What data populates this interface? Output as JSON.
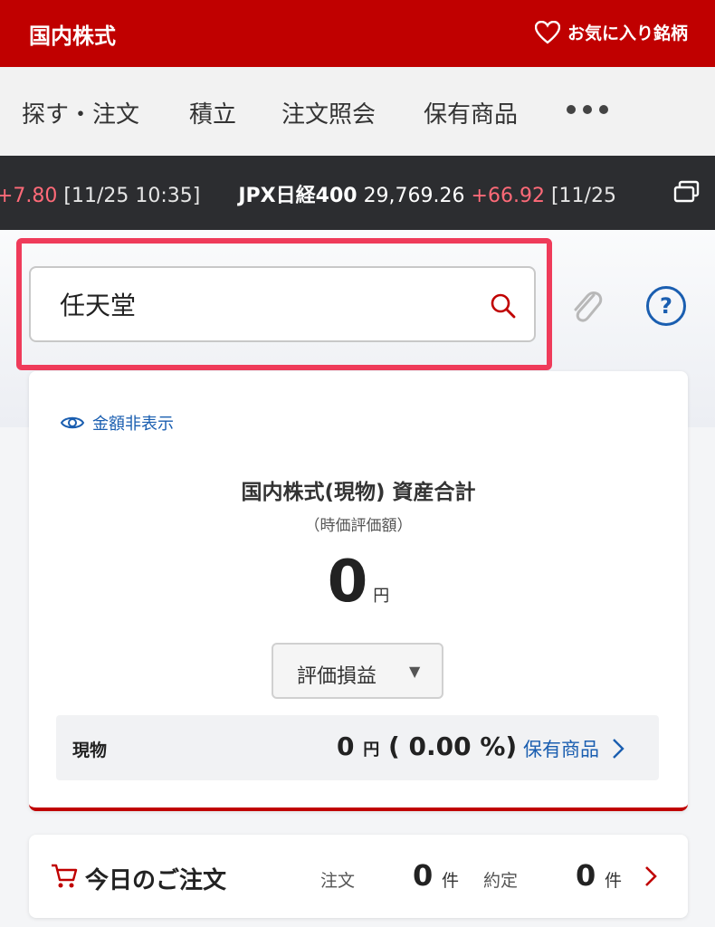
{
  "header": {
    "title": "国内株式",
    "favorites_label": "お気に入り銘柄"
  },
  "nav": {
    "items": [
      "探す・注文",
      "積立",
      "注文照会",
      "保有商品"
    ],
    "more_icon": "ellipsis-icon"
  },
  "ticker": {
    "prev_change": "+7.80",
    "prev_time": "[11/25 10:35]",
    "index_name": "JPX日経400",
    "index_value": "29,769.26",
    "index_change": "+66.92",
    "index_time": "[11/25"
  },
  "search": {
    "value": "任天堂"
  },
  "summary": {
    "toggle_label": "金額非表示",
    "title": "国内株式(現物) 資産合計",
    "subtitle": "（時価評価額）",
    "amount": "0",
    "unit": "円",
    "select_label": "評価損益",
    "holding": {
      "label": "現物",
      "value_html": "0",
      "unit": "円",
      "percent": "( 0.00 %)",
      "link": "保有商品"
    }
  },
  "orders": {
    "title": "今日のご注文",
    "order_label": "注文",
    "order_count": "0",
    "fill_label": "約定",
    "fill_count": "0",
    "count_unit": "件"
  },
  "colors": {
    "brand": "#c00000",
    "link": "#1a5eb0",
    "highlight": "#ef3b5a",
    "ticker_up": "#ff6a78"
  }
}
